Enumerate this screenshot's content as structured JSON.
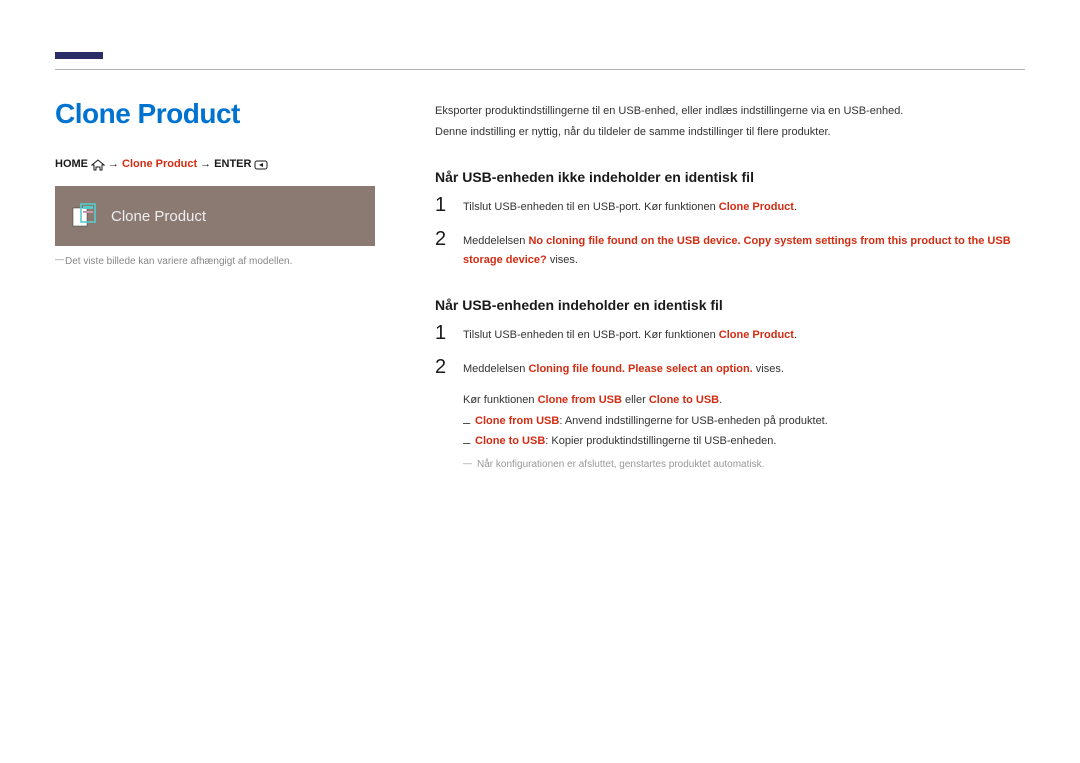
{
  "title": "Clone Product",
  "nav": {
    "home": "HOME",
    "arrow": "→",
    "clone": "Clone Product",
    "enter": "ENTER"
  },
  "preview": {
    "label": "Clone Product"
  },
  "left_footnote": "Det viste billede kan variere afhængigt af modellen.",
  "intro1": "Eksporter produktindstillingerne til en USB-enhed, eller indlæs indstillingerne via en USB-enhed.",
  "intro2": "Denne indstilling er nyttig, når du tildeler de samme indstillinger til flere produkter.",
  "section1": {
    "heading": "Når USB-enheden ikke indeholder en identisk fil",
    "step1_pre": "Tilslut USB-enheden til en USB-port. Kør funktionen ",
    "step1_red": "Clone Product",
    "step1_post": ".",
    "step2_pre": "Meddelelsen ",
    "step2_red": "No cloning file found on the USB device. Copy system settings from this product to the USB storage device?",
    "step2_post": " vises."
  },
  "section2": {
    "heading": "Når USB-enheden indeholder en identisk fil",
    "step1_pre": "Tilslut USB-enheden til en USB-port. Kør funktionen ",
    "step1_red": "Clone Product",
    "step1_post": ".",
    "step2_pre": "Meddelelsen ",
    "step2_red": "Cloning file found. Please select an option.",
    "step2_post": " vises.",
    "run_pre": "Kør funktionen ",
    "run_opt1": "Clone from USB",
    "run_or": " eller ",
    "run_opt2": "Clone to USB",
    "run_post": ".",
    "b1_red": "Clone from USB",
    "b1_rest": ": Anvend indstillingerne for USB-enheden på produktet.",
    "b2_red": "Clone to USB",
    "b2_rest": ": Kopier produktindstillingerne til USB-enheden.",
    "footnote": "Når konfigurationen er afsluttet, genstartes produktet automatisk."
  }
}
